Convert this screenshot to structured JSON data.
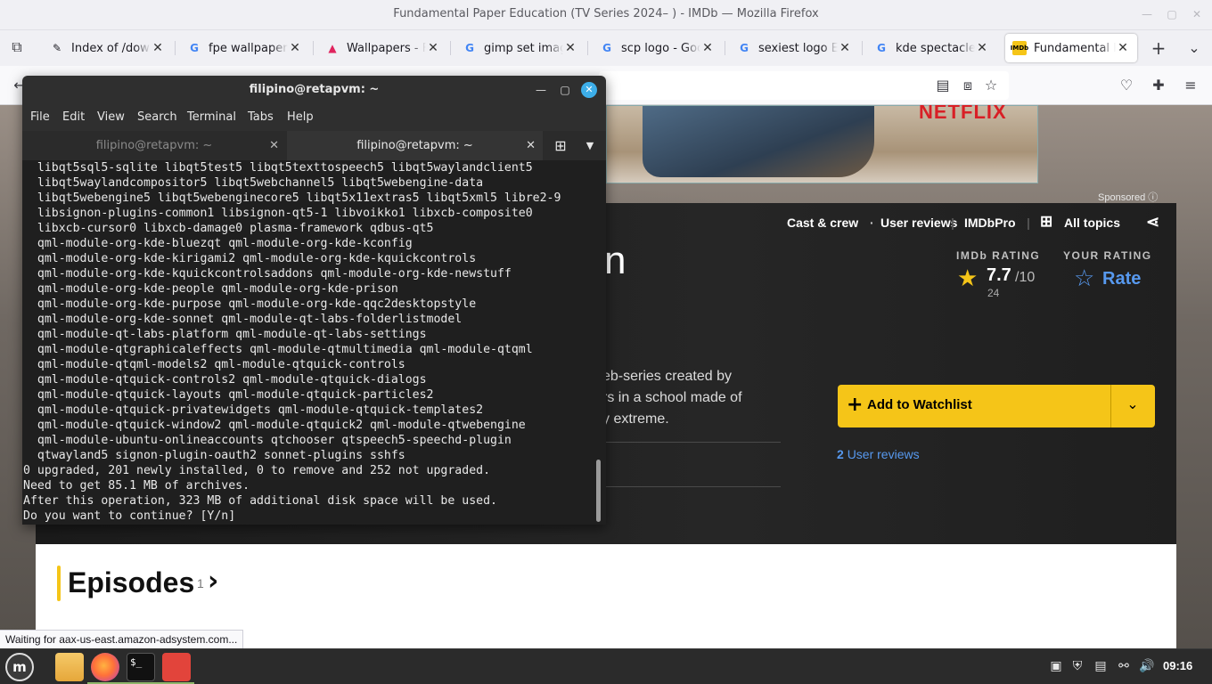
{
  "browser": {
    "window_title": "Fundamental Paper Education (TV Series 2024– ) - IMDb — Mozilla Firefox",
    "tabs": [
      {
        "label": "Index of /downloads",
        "icon": "pin-icon"
      },
      {
        "label": "fpe wallpaper crying",
        "icon": "google-icon"
      },
      {
        "label": "Wallpapers - Fotor",
        "icon": "wallpapers-icon"
      },
      {
        "label": "gimp set image size",
        "icon": "google-icon"
      },
      {
        "label": "scp logo - Google Search",
        "icon": "google-icon"
      },
      {
        "label": "sexiest logo EVER",
        "icon": "google-icon"
      },
      {
        "label": "kde spectacle app",
        "icon": "google-icon"
      },
      {
        "label": "Fundamental Paper Education",
        "icon": "imdb-icon"
      }
    ],
    "status_message": "Waiting for aax-us-east.amazon-adsystem.com..."
  },
  "imdb": {
    "ad_brand": "NETFLIX",
    "sponsored": "Sponsored",
    "nav": {
      "cast": "Cast & crew",
      "reviews": "User reviews",
      "pro": "IMDbPro",
      "topics": "All topics"
    },
    "title_fragment": "n",
    "imdb_rating_label": "IMDb RATING",
    "rating_value": "7.7",
    "rating_max": "/10",
    "rating_count": "24",
    "your_rating_label": "YOUR RATING",
    "rate_label": "Rate",
    "description_lines": [
      "eb-series created by",
      "rs in a school made of",
      "y extreme."
    ],
    "watchlist_label": "Add to Watchlist",
    "user_reviews_count": "2",
    "user_reviews_label": "User reviews",
    "episodes_heading": "Episodes",
    "episodes_count": "1"
  },
  "terminal": {
    "window_title": "filipino@retapvm: ~",
    "menu": [
      "File",
      "Edit",
      "View",
      "Search",
      "Terminal",
      "Tabs",
      "Help"
    ],
    "tabs": [
      "filipino@retapvm: ~",
      "filipino@retapvm: ~"
    ],
    "lines": [
      "  libqt5sql5-sqlite libqt5test5 libqt5texttospeech5 libqt5waylandclient5",
      "  libqt5waylandcompositor5 libqt5webchannel5 libqt5webengine-data",
      "  libqt5webengine5 libqt5webenginecore5 libqt5x11extras5 libqt5xml5 libre2-9",
      "  libsignon-plugins-common1 libsignon-qt5-1 libvoikko1 libxcb-composite0",
      "  libxcb-cursor0 libxcb-damage0 plasma-framework qdbus-qt5",
      "  qml-module-org-kde-bluezqt qml-module-org-kde-kconfig",
      "  qml-module-org-kde-kirigami2 qml-module-org-kde-kquickcontrols",
      "  qml-module-org-kde-kquickcontrolsaddons qml-module-org-kde-newstuff",
      "  qml-module-org-kde-people qml-module-org-kde-prison",
      "  qml-module-org-kde-purpose qml-module-org-kde-qqc2desktopstyle",
      "  qml-module-org-kde-sonnet qml-module-qt-labs-folderlistmodel",
      "  qml-module-qt-labs-platform qml-module-qt-labs-settings",
      "  qml-module-qtgraphicaleffects qml-module-qtmultimedia qml-module-qtqml",
      "  qml-module-qtqml-models2 qml-module-qtquick-controls",
      "  qml-module-qtquick-controls2 qml-module-qtquick-dialogs",
      "  qml-module-qtquick-layouts qml-module-qtquick-particles2",
      "  qml-module-qtquick-privatewidgets qml-module-qtquick-templates2",
      "  qml-module-qtquick-window2 qml-module-qtquick2 qml-module-qtwebengine",
      "  qml-module-ubuntu-onlineaccounts qtchooser qtspeech5-speechd-plugin",
      "  qtwayland5 signon-plugin-oauth2 sonnet-plugins sshfs",
      "0 upgraded, 201 newly installed, 0 to remove and 252 not upgraded.",
      "Need to get 85.1 MB of archives.",
      "After this operation, 323 MB of additional disk space will be used.",
      "Do you want to continue? [Y/n]"
    ]
  },
  "taskbar": {
    "clock": "09:16",
    "apps": [
      "mint-menu-icon",
      "files-icon",
      "firefox-icon",
      "terminal-icon",
      "gimp-icon"
    ]
  }
}
